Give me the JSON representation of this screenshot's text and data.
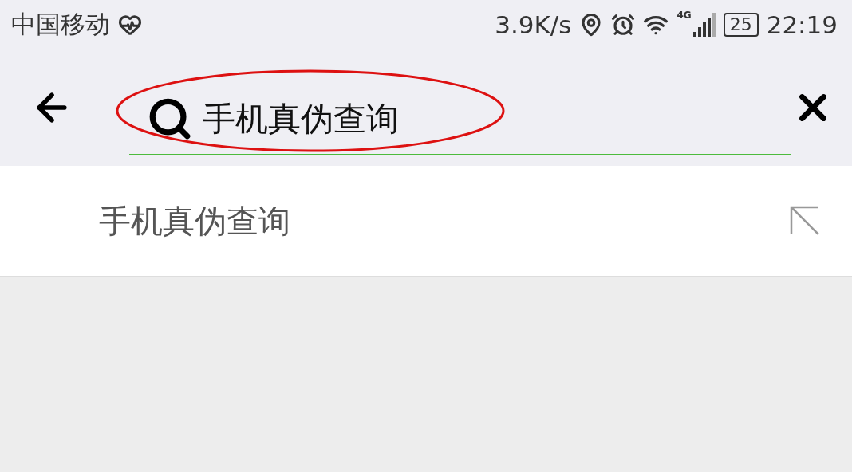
{
  "status_bar": {
    "carrier": "中国移动",
    "speed": "3.9K/s",
    "network": "4G",
    "battery": "25",
    "time": "22:19"
  },
  "search": {
    "value": "手机真伪查询",
    "highlighted": true
  },
  "suggestions": [
    {
      "text": "手机真伪查询"
    }
  ]
}
